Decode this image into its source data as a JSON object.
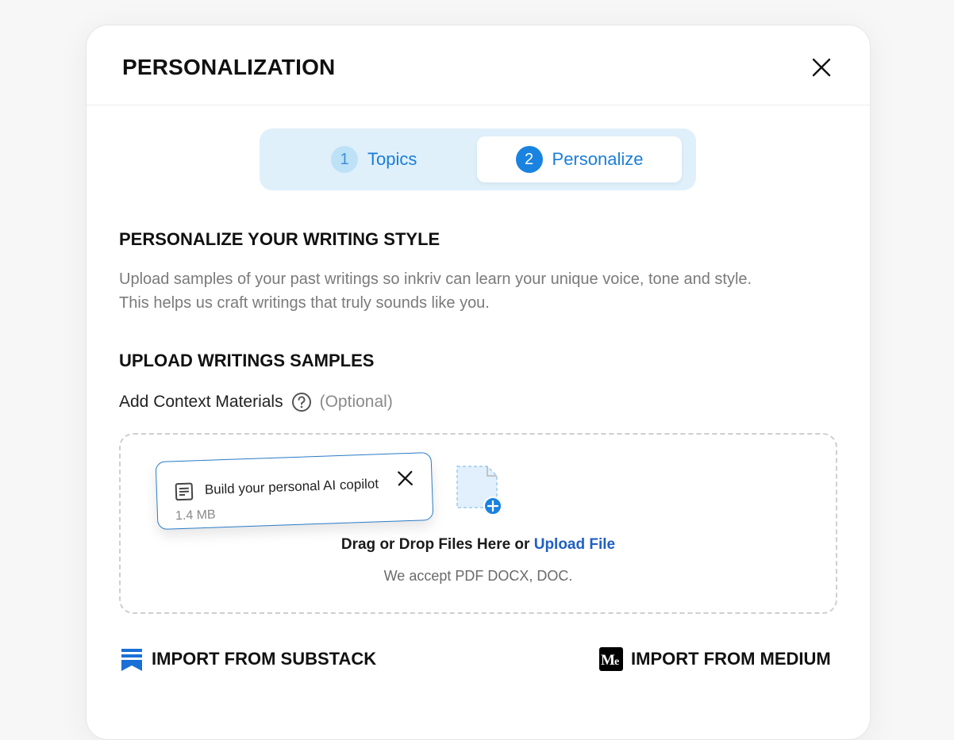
{
  "modal": {
    "title": "PERSONALIZATION"
  },
  "stepper": {
    "steps": [
      {
        "number": "1",
        "label": "Topics",
        "active": false
      },
      {
        "number": "2",
        "label": "Personalize",
        "active": true
      }
    ]
  },
  "style_section": {
    "title": "PERSONALIZE YOUR WRITING STYLE",
    "description_line1": "Upload samples of your past writings so inkriv can learn your unique voice, tone and style.",
    "description_line2": "This helps us craft writings that truly sounds like you."
  },
  "upload_section": {
    "title": "UPLOAD WRITINGS SAMPLES",
    "context_label": "Add Context Materials",
    "optional_label": "(Optional)"
  },
  "dropzone": {
    "file": {
      "name": "Build your personal AI copilot",
      "size": "1.4 MB"
    },
    "drop_text": "Drag or Drop Files Here or",
    "upload_link": "Upload File",
    "accept_text": "We accept PDF DOCX, DOC."
  },
  "imports": {
    "substack": {
      "label": "IMPORT FROM SUBSTACK",
      "icon": "substack-icon"
    },
    "medium": {
      "label": "IMPORT FROM MEDIUM",
      "icon": "medium-icon"
    }
  },
  "colors": {
    "accent": "#1a83e0",
    "stepper_bg": "#dff0fb",
    "link": "#1f5fc4",
    "substack": "#1a6fd6"
  }
}
